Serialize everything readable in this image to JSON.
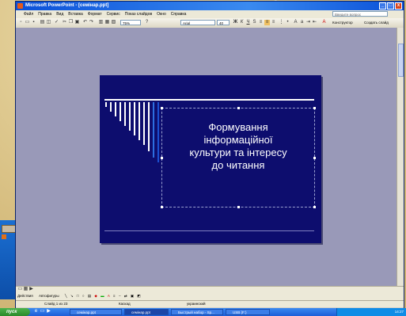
{
  "window": {
    "title": "Microsoft PowerPoint - [семінар.ppt]",
    "controls": {
      "minimize": "_",
      "maximize": "□",
      "close": "x"
    }
  },
  "menu": {
    "items": [
      "Файл",
      "Правка",
      "Вид",
      "Вставка",
      "Формат",
      "Сервис",
      "Показ слайдов",
      "Окно",
      "Справка"
    ],
    "help_placeholder": "Введите вопрос"
  },
  "toolbar": {
    "zoom": "75%",
    "font": "Arial",
    "size": "40",
    "design_label": "Конструктор",
    "new_slide_label": "Создать слайд"
  },
  "slide": {
    "title_lines": [
      "Формування",
      "інформаційної",
      "культури та інтересу",
      "до читання"
    ]
  },
  "drawbar": {
    "actions_label": "Действия",
    "autoshapes_label": "Автофигуры"
  },
  "status": {
    "slide_counter": "Слайд 1 из 23",
    "design_name": "Каскад",
    "language": "украинский"
  },
  "taskbar": {
    "start_label": "пуск",
    "items": [
      "семінар.ppt",
      "семінар.ppt",
      "Быстрый набор - Sp...",
      "USB (F:)"
    ],
    "clock": "14:27"
  },
  "colors": {
    "slide_bg": "#0d0d6e",
    "workspace_bg": "#9999b8",
    "titlebar": "#0a50d8"
  }
}
